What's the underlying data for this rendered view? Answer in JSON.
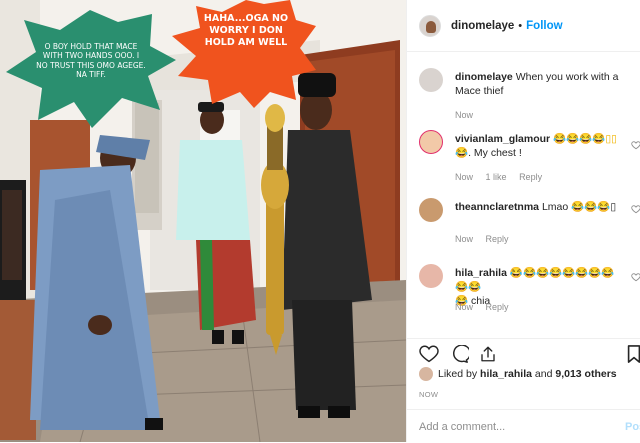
{
  "photo": {
    "bubble_left": "O boy hold that mace with two hands ooo. I no trust this omo Agege. Na tiff.",
    "bubble_right": "Haha...Oga no worry I don hold am well"
  },
  "header": {
    "username": "dinomelaye",
    "dot": "•",
    "follow_label": "Follow",
    "more_icon": "more-horizontal-icon"
  },
  "caption": {
    "username": "dinomelaye",
    "text": "When you work with a Mace thief",
    "age": "Now"
  },
  "comments": [
    {
      "username": "vivianlam_glamour",
      "text_line1": "😂😂😂😂▯▯",
      "text_line2": "😂. My chest !",
      "age": "Now",
      "likes": "1 like",
      "reply": "Reply"
    },
    {
      "username": "theannclaretnma",
      "text_line1": "Lmao 😂😂😂▯",
      "text_line2": "",
      "age": "Now",
      "likes": "",
      "reply": "Reply"
    },
    {
      "username": "hila_rahila",
      "text_line1": "😂😂😂😂😂😂😂😂😂😂",
      "text_line2": "😂 chia",
      "age": "Now",
      "likes": "",
      "reply": "Reply"
    }
  ],
  "actions": {
    "liked_by_prefix": "Liked by",
    "liked_by_user": "hila_rahila",
    "liked_by_and": "and",
    "liked_by_count": "9,013 others",
    "timestamp": "NOW",
    "comment_placeholder": "Add a comment...",
    "post_label": "Post"
  },
  "colors": {
    "follow_blue": "#0095f6",
    "bubble_green": "#2a8f6f",
    "bubble_orange": "#f0531e",
    "post_disabled": "#b2dffc"
  }
}
